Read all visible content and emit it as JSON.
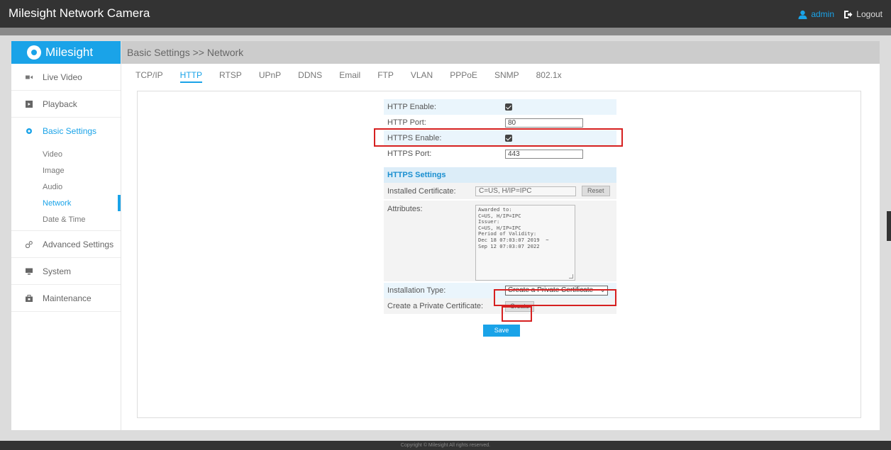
{
  "app": {
    "title": "Milesight Network Camera",
    "user": "admin",
    "logout": "Logout",
    "logo_text": "Milesight",
    "footer": "Copyright © Milesight All rights reserved.",
    "accent_color": "#1aa3e8"
  },
  "sidebar": {
    "items": [
      {
        "label": "Live Video",
        "icon": "video-camera-icon"
      },
      {
        "label": "Playback",
        "icon": "playback-icon"
      },
      {
        "label": "Basic Settings",
        "icon": "gear-icon",
        "active": true
      },
      {
        "label": "Advanced Settings",
        "icon": "gears-icon"
      },
      {
        "label": "System",
        "icon": "monitor-icon"
      },
      {
        "label": "Maintenance",
        "icon": "toolbox-icon"
      }
    ],
    "subitems": [
      {
        "label": "Video"
      },
      {
        "label": "Image"
      },
      {
        "label": "Audio"
      },
      {
        "label": "Network",
        "active": true
      },
      {
        "label": "Date & Time"
      }
    ]
  },
  "breadcrumb": "Basic Settings >> Network",
  "tabs": [
    "TCP/IP",
    "HTTP",
    "RTSP",
    "UPnP",
    "DDNS",
    "Email",
    "FTP",
    "VLAN",
    "PPPoE",
    "SNMP",
    "802.1x"
  ],
  "active_tab": "HTTP",
  "form": {
    "http_enable_label": "HTTP Enable:",
    "http_enable": true,
    "http_port_label": "HTTP Port:",
    "http_port": "80",
    "https_enable_label": "HTTPS Enable:",
    "https_enable": true,
    "https_port_label": "HTTPS Port:",
    "https_port": "443",
    "https_settings_title": "HTTPS Settings",
    "installed_cert_label": "Installed Certificate:",
    "installed_cert": "C=US, H/IP=IPC",
    "reset_label": "Reset",
    "attributes_label": "Attributes:",
    "attributes_text": "Awarded to:\nC=US, H/IP=IPC\nIssuer:\nC=US, H/IP=IPC\nPeriod of Validity:\nDec 18 07:03:07 2019  ~\nSep 12 07:03:07 2022",
    "installation_type_label": "Installation Type:",
    "installation_type": "Create a Private Certificate",
    "create_private_label": "Create a Private Certificate:",
    "create_label": "Create",
    "save_label": "Save"
  }
}
